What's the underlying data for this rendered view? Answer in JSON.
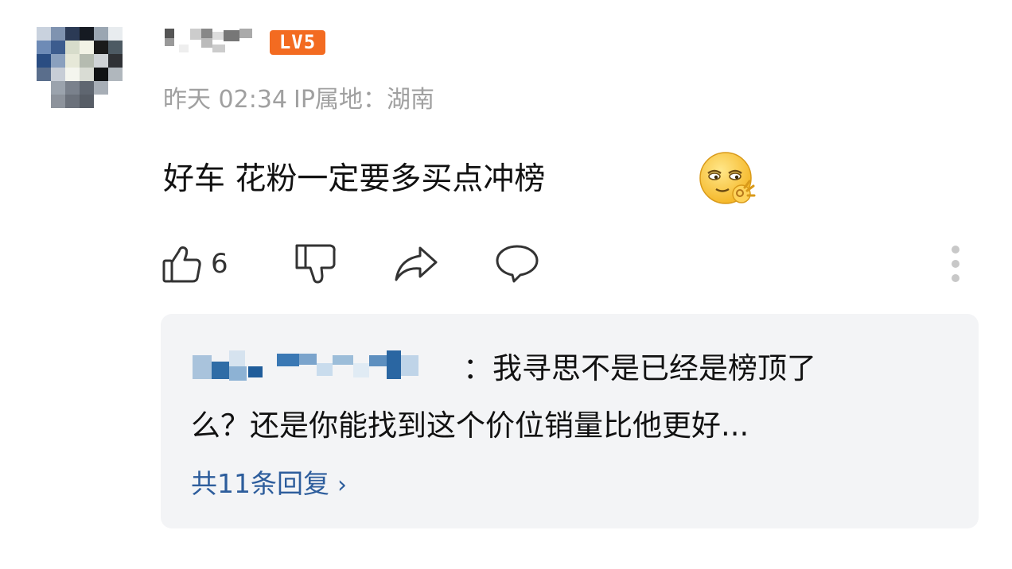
{
  "comment": {
    "level_badge": "LV5",
    "time": "昨天 02:34",
    "ip_location": "IP属地：湖南",
    "text": "好车  花粉一定要多买点冲榜",
    "emoji": "smirk-ok-emoji",
    "like_count": "6"
  },
  "actions": {
    "like_icon": "thumbs-up-icon",
    "dislike_icon": "thumbs-down-icon",
    "share_icon": "share-arrow-icon",
    "reply_icon": "speech-bubble-icon",
    "more_icon": "vertical-dots-icon"
  },
  "reply_preview": {
    "text_line1": "：我寻思不是已经是榜顶了",
    "text_line2": "么？还是你能找到这个价位销量比他更好...",
    "view_all_label": "共11条回复",
    "chevron": "›"
  },
  "colors": {
    "badge": "#f36b21",
    "link": "#2d5d9c",
    "meta_text": "#a0a0a0",
    "reply_bg": "#f3f4f6"
  }
}
